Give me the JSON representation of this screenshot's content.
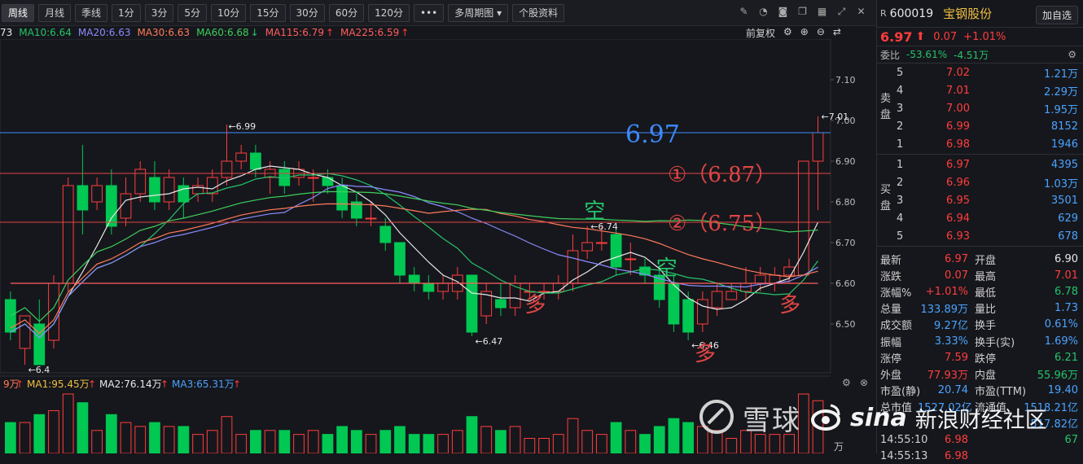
{
  "toolbar": {
    "periods": [
      "周线",
      "月线",
      "季线",
      "1分",
      "3分",
      "5分",
      "10分",
      "15分",
      "30分",
      "60分",
      "120分"
    ],
    "more": "•••",
    "multi": "多周期图",
    "profile": "个股资料",
    "fuquan": "前复权"
  },
  "ma_legend": [
    {
      "label": "73",
      "color": "#e8e8e8"
    },
    {
      "label": "MA10:6.64",
      "color": "#25c36a"
    },
    {
      "label": "MA20:6.63",
      "color": "#8a8cff"
    },
    {
      "label": "MA30:6.63",
      "color": "#ff7a5a"
    },
    {
      "label": "MA60:6.68",
      "color": "#3fcf5c"
    },
    {
      "label": "MA115:6.79",
      "color": "#ff5e5e"
    },
    {
      "label": "MA225:6.59",
      "color": "#ff5e5e"
    }
  ],
  "y_ticks": [
    "7.10",
    "7.00",
    "6.90",
    "6.80",
    "6.70",
    "6.60",
    "6.50"
  ],
  "chart_data": {
    "type": "candlestick",
    "ylim": [
      6.38,
      7.2
    ],
    "price_labels": [
      "7.01",
      "6.99",
      "6.74",
      "6.47",
      "6.46",
      "6.4"
    ],
    "last_price_label": "6.97",
    "levels": [
      {
        "label": "①（6.87）",
        "value": 6.87
      },
      {
        "label": "②（6.75）",
        "value": 6.75
      }
    ],
    "annotations": [
      "空",
      "空",
      "多",
      "多",
      "多"
    ],
    "candles": [
      [
        6.56,
        6.48,
        6.58,
        6.46
      ],
      [
        6.44,
        6.52,
        6.52,
        6.4
      ],
      [
        6.5,
        6.4,
        6.56,
        6.4
      ],
      [
        6.46,
        6.6,
        6.62,
        6.44
      ],
      [
        6.6,
        6.84,
        6.86,
        6.58
      ],
      [
        6.84,
        6.78,
        6.94,
        6.72
      ],
      [
        6.8,
        6.84,
        6.86,
        6.78
      ],
      [
        6.84,
        6.74,
        6.88,
        6.72
      ],
      [
        6.76,
        6.82,
        6.86,
        6.74
      ],
      [
        6.82,
        6.88,
        6.9,
        6.8
      ],
      [
        6.86,
        6.8,
        6.9,
        6.78
      ],
      [
        6.8,
        6.86,
        6.88,
        6.78
      ],
      [
        6.84,
        6.8,
        6.86,
        6.76
      ],
      [
        6.82,
        6.84,
        6.86,
        6.8
      ],
      [
        6.82,
        6.86,
        6.88,
        6.8
      ],
      [
        6.86,
        6.9,
        6.99,
        6.84
      ],
      [
        6.9,
        6.92,
        6.94,
        6.88
      ],
      [
        6.92,
        6.88,
        6.94,
        6.86
      ],
      [
        6.86,
        6.88,
        6.9,
        6.82
      ],
      [
        6.88,
        6.84,
        6.9,
        6.82
      ],
      [
        6.86,
        6.88,
        6.9,
        6.84
      ],
      [
        6.86,
        6.86,
        6.88,
        6.8
      ],
      [
        6.86,
        6.84,
        6.88,
        6.82
      ],
      [
        6.84,
        6.78,
        6.86,
        6.76
      ],
      [
        6.8,
        6.76,
        6.82,
        6.74
      ],
      [
        6.76,
        6.76,
        6.8,
        6.74
      ],
      [
        6.74,
        6.7,
        6.76,
        6.68
      ],
      [
        6.7,
        6.62,
        6.7,
        6.6
      ],
      [
        6.62,
        6.6,
        6.64,
        6.58
      ],
      [
        6.6,
        6.58,
        6.62,
        6.56
      ],
      [
        6.58,
        6.6,
        6.62,
        6.56
      ],
      [
        6.58,
        6.62,
        6.64,
        6.56
      ],
      [
        6.62,
        6.48,
        6.62,
        6.47
      ],
      [
        6.52,
        6.58,
        6.6,
        6.5
      ],
      [
        6.56,
        6.54,
        6.6,
        6.52
      ],
      [
        6.54,
        6.6,
        6.62,
        6.52
      ],
      [
        6.58,
        6.58,
        6.6,
        6.56
      ],
      [
        6.58,
        6.58,
        6.6,
        6.56
      ],
      [
        6.58,
        6.6,
        6.62,
        6.56
      ],
      [
        6.6,
        6.68,
        6.72,
        6.58
      ],
      [
        6.68,
        6.7,
        6.74,
        6.66
      ],
      [
        6.7,
        6.7,
        6.74,
        6.68
      ],
      [
        6.72,
        6.64,
        6.74,
        6.62
      ],
      [
        6.66,
        6.66,
        6.7,
        6.62
      ],
      [
        6.64,
        6.62,
        6.66,
        6.6
      ],
      [
        6.62,
        6.56,
        6.64,
        6.54
      ],
      [
        6.6,
        6.5,
        6.62,
        6.48
      ],
      [
        6.56,
        6.48,
        6.58,
        6.46
      ],
      [
        6.5,
        6.56,
        6.58,
        6.48
      ],
      [
        6.54,
        6.58,
        6.6,
        6.52
      ],
      [
        6.56,
        6.58,
        6.6,
        6.56
      ],
      [
        6.58,
        6.6,
        6.64,
        6.56
      ],
      [
        6.6,
        6.62,
        6.64,
        6.58
      ],
      [
        6.6,
        6.62,
        6.64,
        6.58
      ],
      [
        6.62,
        6.64,
        6.66,
        6.6
      ],
      [
        6.62,
        6.9,
        6.9,
        6.62
      ],
      [
        6.9,
        6.97,
        7.01,
        6.78
      ]
    ]
  },
  "volume": {
    "legend": [
      {
        "label": "9万",
        "color": "#ff7a5a"
      },
      {
        "label": "MA1:95.45万",
        "color": "#f0c040"
      },
      {
        "label": "MA2:76.14万",
        "color": "#e8e8e8"
      },
      {
        "label": "MA3:65.31万",
        "color": "#4aa3ff"
      }
    ],
    "unit": "万"
  },
  "stock": {
    "tag": "R",
    "code": "600019",
    "name": "宝钢股份",
    "add_btn": "加自选",
    "price": "6.97",
    "change": "0.07",
    "change_pct": "+1.01%",
    "weibi_label": "委比",
    "weibi": "-53.61%",
    "weicha": "-4.51万"
  },
  "book": {
    "sell_label": "卖盘",
    "buy_label": "买盘",
    "asks": [
      {
        "i": "5",
        "p": "7.02",
        "v": "1.21万"
      },
      {
        "i": "4",
        "p": "7.01",
        "v": "2.29万"
      },
      {
        "i": "3",
        "p": "7.00",
        "v": "1.95万"
      },
      {
        "i": "2",
        "p": "6.99",
        "v": "8152"
      },
      {
        "i": "1",
        "p": "6.98",
        "v": "1946"
      }
    ],
    "bids": [
      {
        "i": "1",
        "p": "6.97",
        "v": "4395"
      },
      {
        "i": "2",
        "p": "6.96",
        "v": "1.03万"
      },
      {
        "i": "3",
        "p": "6.95",
        "v": "3501"
      },
      {
        "i": "4",
        "p": "6.94",
        "v": "629"
      },
      {
        "i": "5",
        "p": "6.93",
        "v": "678"
      }
    ]
  },
  "stats": [
    {
      "l1": "最新",
      "v1": "6.97",
      "c1": "red",
      "l2": "开盘",
      "v2": "6.90",
      "c2": "white"
    },
    {
      "l1": "涨跌",
      "v1": "0.07",
      "c1": "red",
      "l2": "最高",
      "v2": "7.01",
      "c2": "red"
    },
    {
      "l1": "涨幅%",
      "v1": "+1.01%",
      "c1": "red",
      "l2": "最低",
      "v2": "6.78",
      "c2": "green"
    },
    {
      "l1": "总量",
      "v1": "133.89万",
      "c1": "blue",
      "l2": "量比",
      "v2": "1.73",
      "c2": "blue"
    },
    {
      "l1": "成交额",
      "v1": "9.27亿",
      "c1": "blue",
      "l2": "换手",
      "v2": "0.61%",
      "c2": "blue"
    },
    {
      "l1": "振幅",
      "v1": "3.33%",
      "c1": "blue",
      "l2": "换手(实)",
      "v2": "1.69%",
      "c2": "blue"
    },
    {
      "l1": "涨停",
      "v1": "7.59",
      "c1": "red",
      "l2": "跌停",
      "v2": "6.21",
      "c2": "green"
    },
    {
      "l1": "外盘",
      "v1": "77.93万",
      "c1": "red",
      "l2": "内盘",
      "v2": "55.96万",
      "c2": "green"
    },
    {
      "l1": "市盈(静)",
      "v1": "20.74",
      "c1": "blue",
      "l2": "市盈(TTM)",
      "v2": "19.40",
      "c2": "blue"
    },
    {
      "l1": "总市值",
      "v1": "1527.02亿",
      "c1": "blue",
      "l2": "流通值",
      "v2": "1518.21亿",
      "c2": "blue"
    },
    {
      "l1": "",
      "v1": "",
      "c1": "blue",
      "l2": "",
      "v2": "517.82亿",
      "c2": "blue"
    },
    {
      "l1": "14:55:10",
      "v1": "6.98",
      "c1": "red",
      "l2": "",
      "v2": "67",
      "c2": "green"
    },
    {
      "l1": "14:55:13",
      "v1": "6.98",
      "c1": "red",
      "l2": "",
      "v2": "",
      "c2": "blue"
    }
  ],
  "watermark": {
    "xueqiu": "雪球",
    "sina": "sina",
    "cj": "新浪财经社区"
  }
}
